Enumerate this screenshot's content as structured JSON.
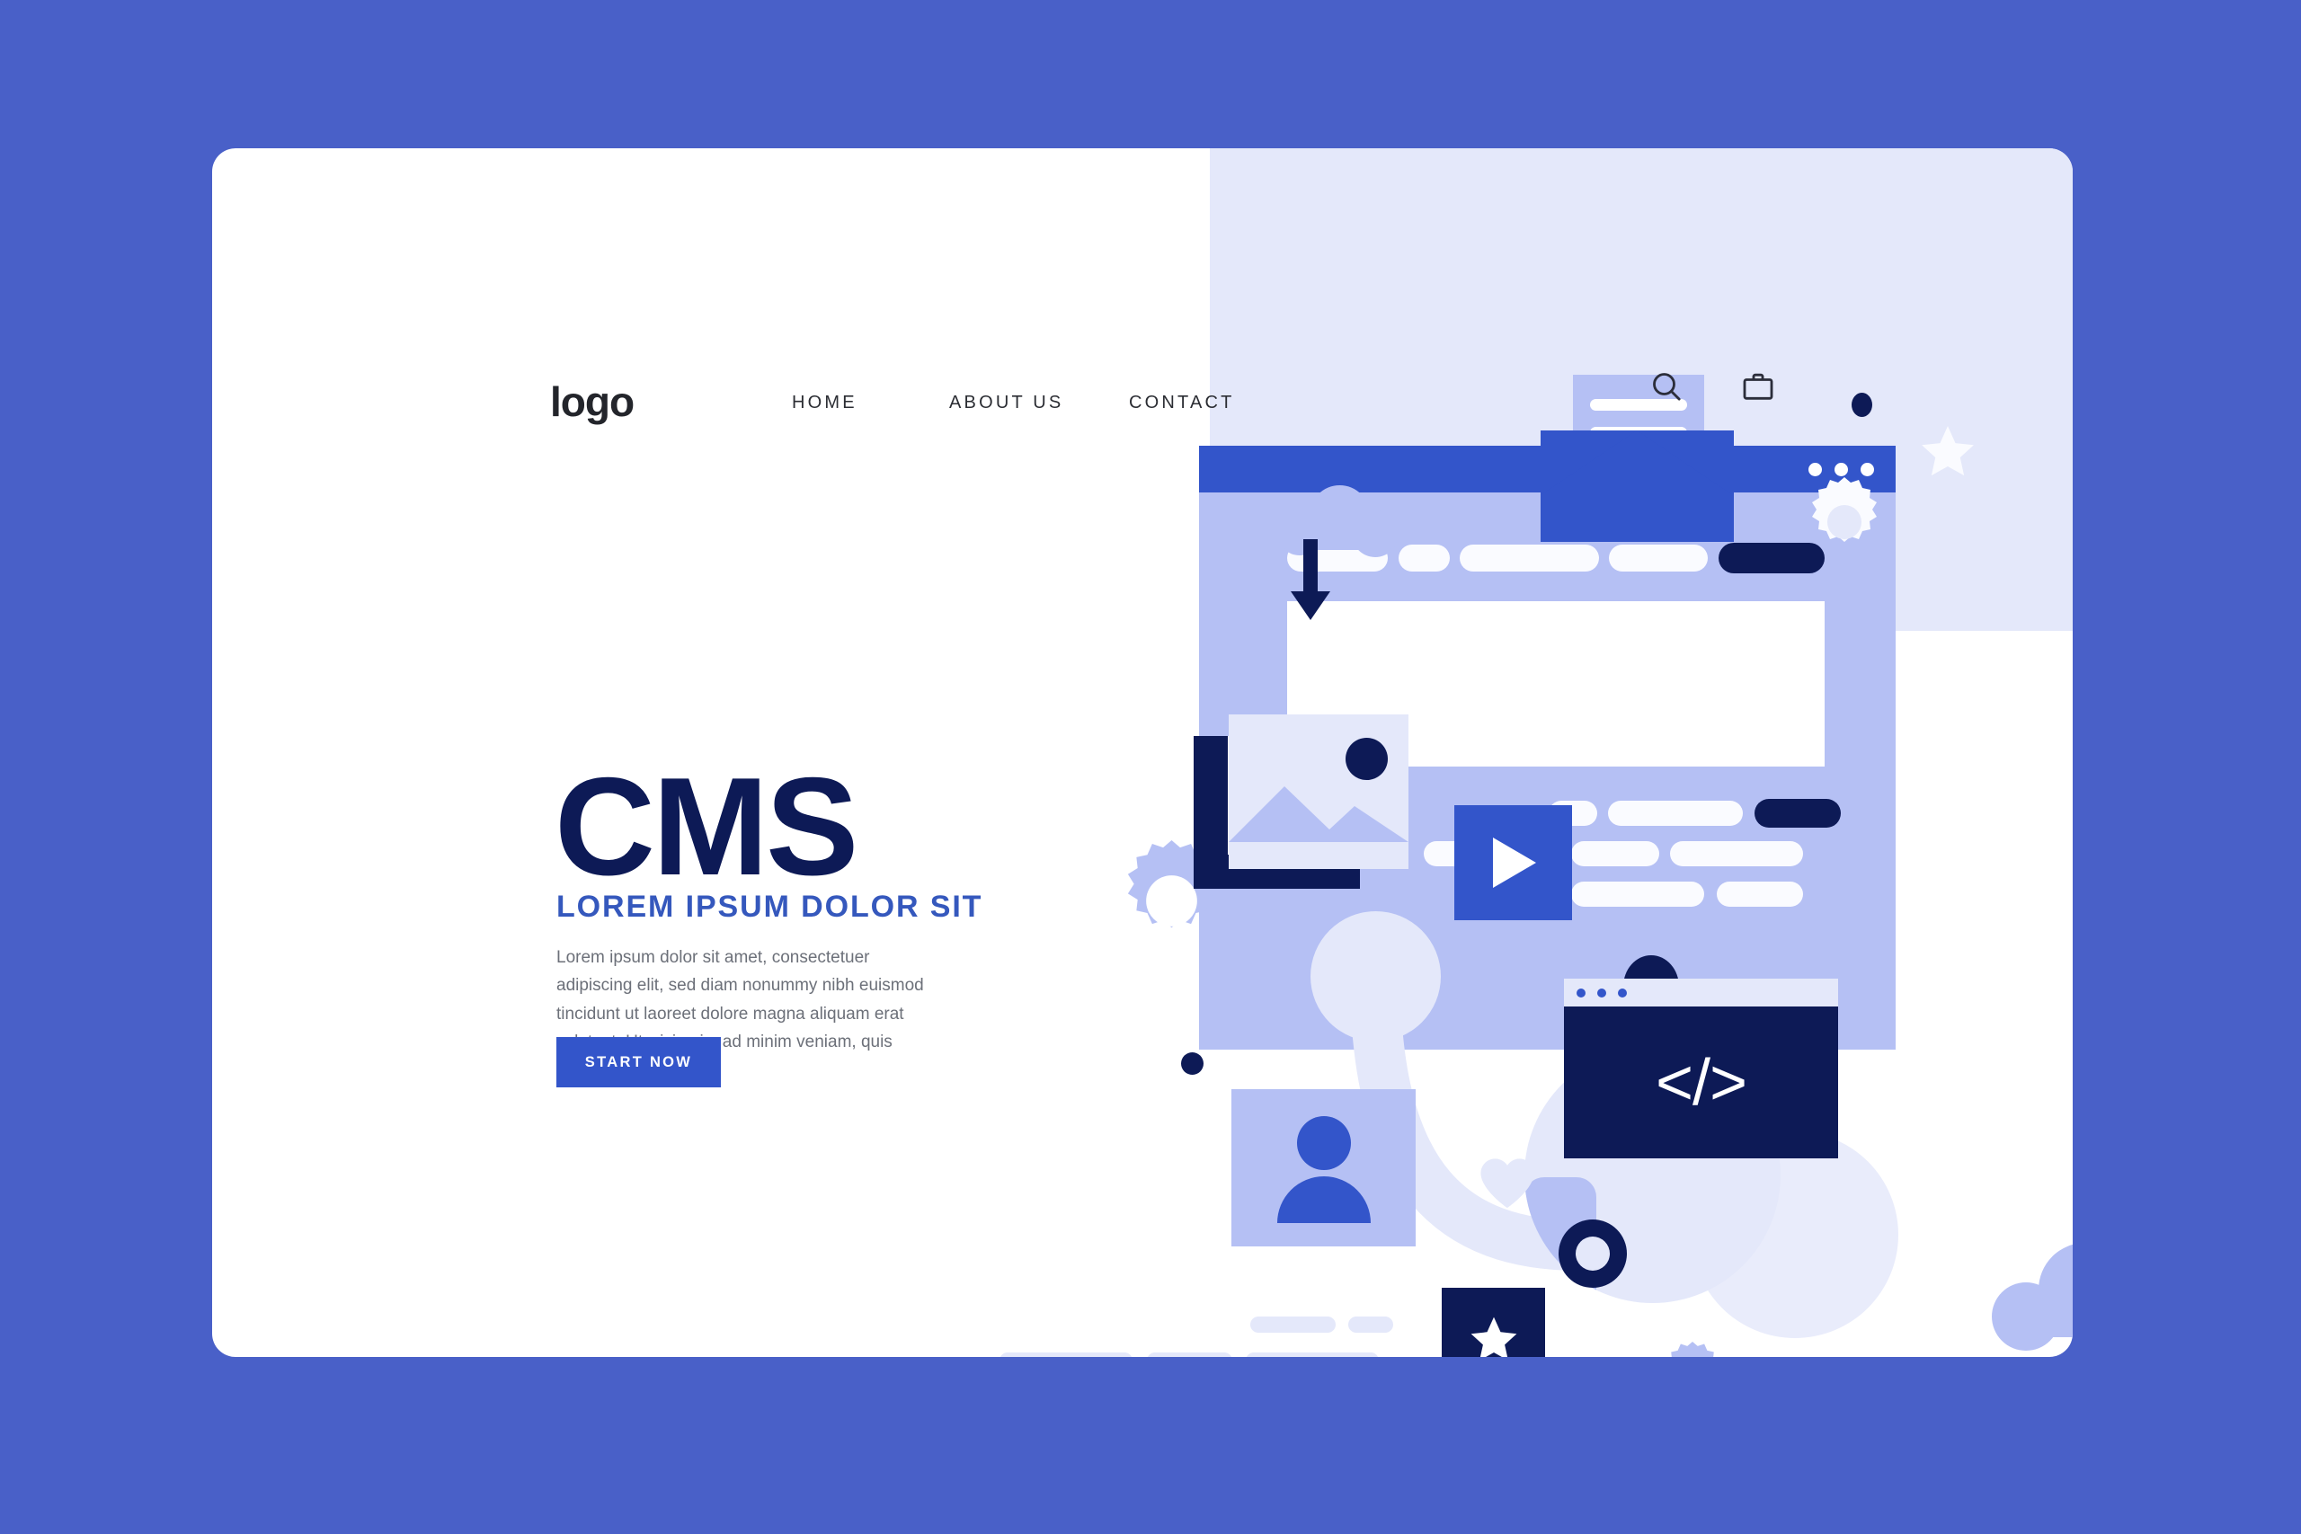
{
  "page": {
    "background_color": "#4960c8",
    "card_background": "#ffffff"
  },
  "colors": {
    "brand_blue": "#3355ca",
    "navy": "#0d1a56",
    "periwinkle": "#b5c0f4",
    "lavender": "#e4e8fa",
    "page_blue": "#4960c8",
    "body_gray": "#6c7079",
    "subtitle_blue": "#3558bd"
  },
  "header": {
    "logo": "logo",
    "nav_items": [
      {
        "label": "HOME"
      },
      {
        "label": "ABOUT US"
      },
      {
        "label": "CONTACT"
      }
    ],
    "icons": [
      {
        "name": "search-icon"
      },
      {
        "name": "briefcase-icon"
      }
    ]
  },
  "hero": {
    "title": "CMS",
    "subtitle": "LOREM IPSUM DOLOR SIT",
    "body": "Lorem ipsum dolor sit amet, consectetuer adipiscing elit, sed diam nonummy nibh euismod tincidunt ut laoreet dolore magna aliquam erat volutpat. Ut wisi enim ad minim veniam, quis nostrud",
    "cta_label": "START NOW"
  },
  "footer": {
    "social": [
      {
        "name": "twitter-icon"
      },
      {
        "name": "instagram-icon"
      },
      {
        "name": "facebook-icon"
      }
    ]
  },
  "illustration": {
    "code_glyph": "</>",
    "browser_window": {
      "dots": 3,
      "nav_pills": 5,
      "highlight_pill_color": "#0d1a56"
    },
    "code_window": {
      "dots": 3
    },
    "elements": [
      "cloud-upload-icon",
      "envelope-icon",
      "image-placeholder-icon",
      "gear-icon",
      "star-icon",
      "heart-icon",
      "play-button-icon",
      "avatar-icon",
      "robot-icon",
      "cloud-icon",
      "person-icon",
      "code-window"
    ]
  }
}
